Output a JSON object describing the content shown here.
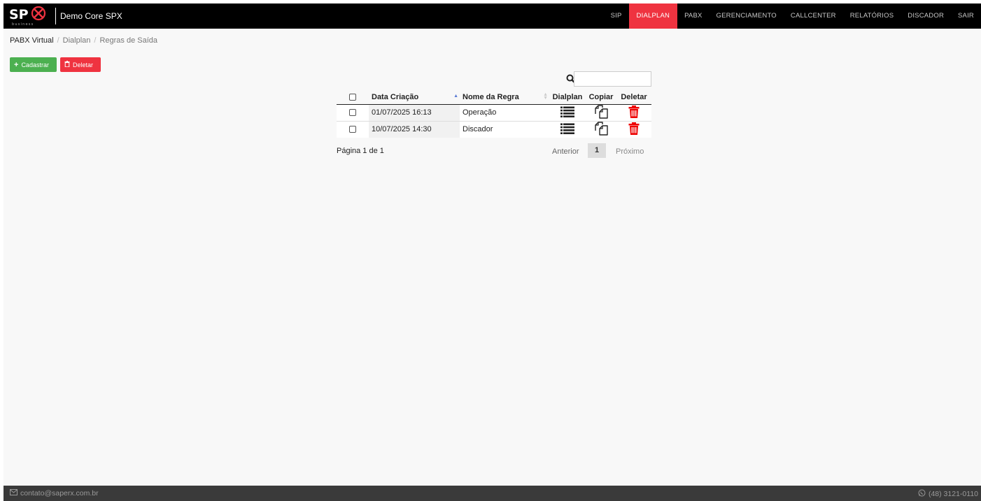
{
  "header": {
    "brand_title": "Demo Core SPX",
    "logo_text": "SP",
    "logo_subtext": "business",
    "nav": [
      {
        "label": "SIP",
        "active": false
      },
      {
        "label": "DIALPLAN",
        "active": true
      },
      {
        "label": "PABX",
        "active": false
      },
      {
        "label": "GERENCIAMENTO",
        "active": false
      },
      {
        "label": "CALLCENTER",
        "active": false
      },
      {
        "label": "RELATÓRIOS",
        "active": false
      },
      {
        "label": "DISCADOR",
        "active": false
      },
      {
        "label": "SAIR",
        "active": false
      }
    ]
  },
  "breadcrumb": [
    "PABX Virtual",
    "Dialplan",
    "Regras de Saída"
  ],
  "actions": {
    "register_label": "Cadastrar",
    "delete_label": "Deletar"
  },
  "search": {
    "value": ""
  },
  "table": {
    "columns": {
      "date": "Data Criação",
      "name": "Nome da Regra",
      "dialplan": "Dialplan",
      "copy": "Copiar",
      "delete": "Deletar"
    },
    "rows": [
      {
        "date": "01/07/2025 16:13",
        "name": "Operação"
      },
      {
        "date": "10/07/2025 14:30",
        "name": "Discador"
      }
    ]
  },
  "pagination": {
    "info": "Página 1 de 1",
    "prev": "Anterior",
    "current": "1",
    "next": "Próximo"
  },
  "footer": {
    "email": "contato@saperx.com.br",
    "phone": "(48) 3121-0110"
  },
  "colors": {
    "accent_red": "#ef3340",
    "green": "#4cb050",
    "navbar": "#000000",
    "footer": "#3a3a3a"
  },
  "icons": [
    "search-icon",
    "plus-icon",
    "trash-icon",
    "list-icon",
    "copy-icon",
    "envelope-icon",
    "whatsapp-icon"
  ]
}
